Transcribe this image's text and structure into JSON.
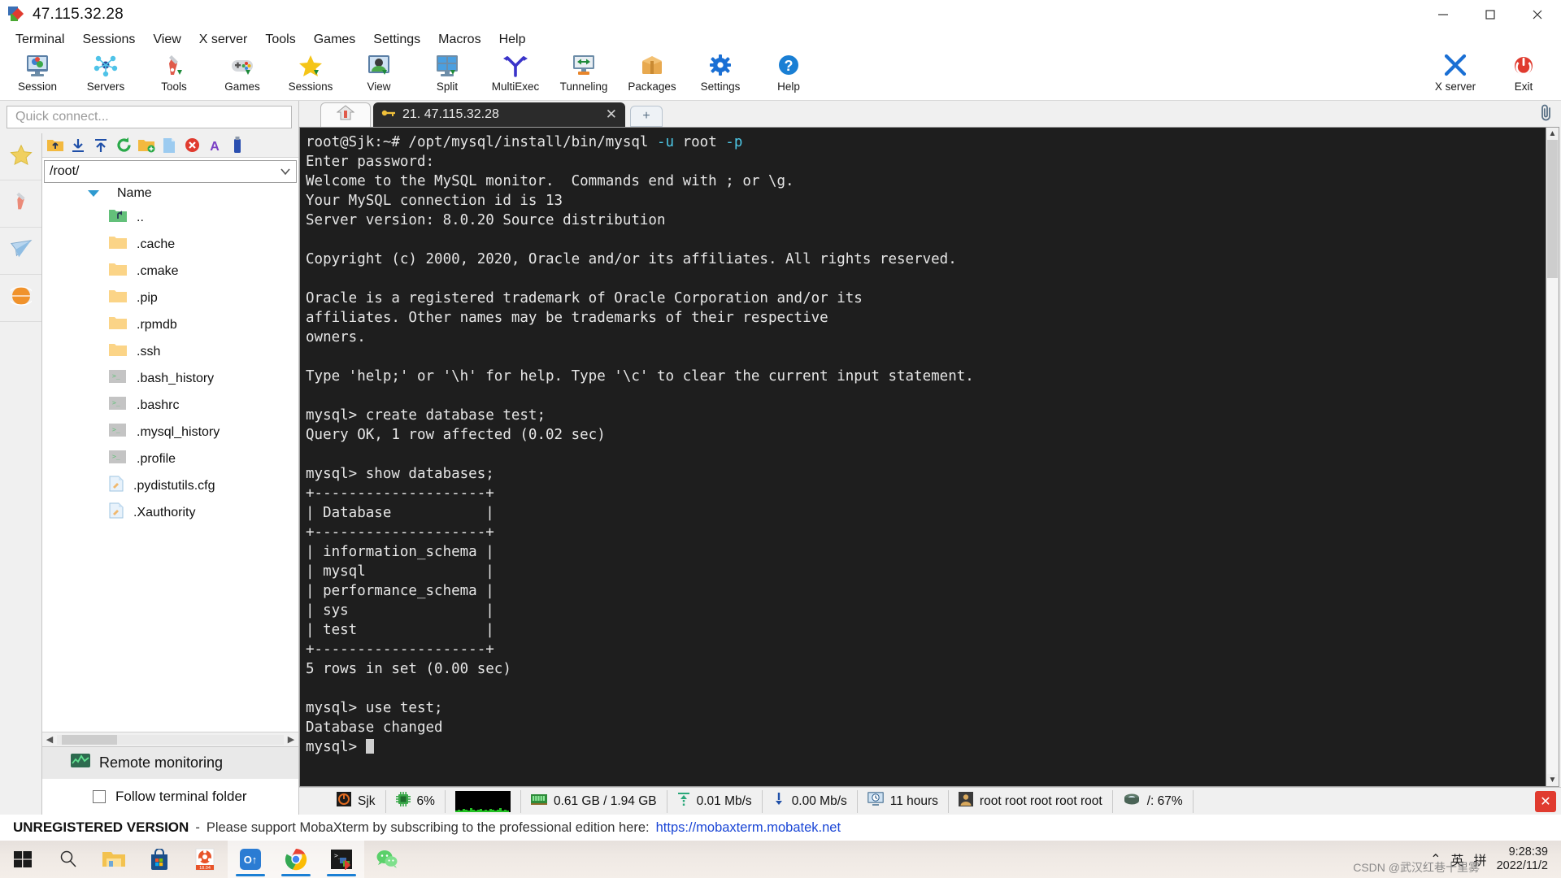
{
  "window": {
    "title": "47.115.32.28",
    "icon": "mobaxterm-logo-icon",
    "minimize": "−",
    "maximize": "▢",
    "close": "✕"
  },
  "menubar": {
    "items": [
      {
        "label": "Terminal"
      },
      {
        "label": "Sessions"
      },
      {
        "label": "View"
      },
      {
        "label": "X server"
      },
      {
        "label": "Tools"
      },
      {
        "label": "Games"
      },
      {
        "label": "Settings"
      },
      {
        "label": "Macros"
      },
      {
        "label": "Help"
      }
    ]
  },
  "ribbon": {
    "buttons": [
      {
        "label": "Session",
        "icon": "session-monitor-icon"
      },
      {
        "label": "Servers",
        "icon": "servers-network-icon"
      },
      {
        "label": "Tools",
        "icon": "swiss-knife-icon"
      },
      {
        "label": "Games",
        "icon": "gamepad-icon"
      },
      {
        "label": "Sessions",
        "icon": "star-icon"
      },
      {
        "label": "View",
        "icon": "view-person-icon"
      },
      {
        "label": "Split",
        "icon": "split-grid-icon"
      },
      {
        "label": "MultiExec",
        "icon": "multiexec-fork-icon"
      },
      {
        "label": "Tunneling",
        "icon": "tunneling-arrows-icon"
      },
      {
        "label": "Packages",
        "icon": "packages-box-icon"
      },
      {
        "label": "Settings",
        "icon": "settings-gear-icon"
      },
      {
        "label": "Help",
        "icon": "help-question-icon"
      }
    ],
    "right_buttons": [
      {
        "label": "X server",
        "icon": "x-server-icon"
      },
      {
        "label": "Exit",
        "icon": "power-exit-icon"
      }
    ]
  },
  "sidebar": {
    "quick_connect_placeholder": "Quick connect...",
    "vertical_tabs": [
      {
        "name": "sessions-star-tab",
        "icon": "star-icon"
      },
      {
        "name": "tools-tab",
        "icon": "swiss-knife-icon"
      },
      {
        "name": "sftp-tab",
        "icon": "paper-plane-icon"
      },
      {
        "name": "macros-tab",
        "icon": "globe-icon"
      }
    ],
    "file_toolbar": [
      {
        "name": "parent-folder-button",
        "icon": "folder-up-icon"
      },
      {
        "name": "download-button",
        "icon": "download-arrow-icon"
      },
      {
        "name": "upload-button",
        "icon": "upload-arrow-icon"
      },
      {
        "name": "refresh-button",
        "icon": "refresh-circle-icon"
      },
      {
        "name": "new-folder-button",
        "icon": "new-folder-icon"
      },
      {
        "name": "new-file-button",
        "icon": "new-file-icon"
      },
      {
        "name": "delete-button",
        "icon": "delete-red-x-icon"
      },
      {
        "name": "text-mode-button",
        "icon": "text-A-icon"
      },
      {
        "name": "binary-mode-button",
        "icon": "usb-stick-icon"
      }
    ],
    "path": "/root/",
    "column_header": "Name",
    "files": [
      {
        "name": "..",
        "type": "parent"
      },
      {
        "name": ".cache",
        "type": "folder"
      },
      {
        "name": ".cmake",
        "type": "folder"
      },
      {
        "name": ".pip",
        "type": "folder"
      },
      {
        "name": ".rpmdb",
        "type": "folder"
      },
      {
        "name": ".ssh",
        "type": "folder"
      },
      {
        "name": ".bash_history",
        "type": "script"
      },
      {
        "name": ".bashrc",
        "type": "script"
      },
      {
        "name": ".mysql_history",
        "type": "script"
      },
      {
        "name": ".profile",
        "type": "script"
      },
      {
        "name": ".pydistutils.cfg",
        "type": "file"
      },
      {
        "name": ".Xauthority",
        "type": "file"
      }
    ],
    "remote_monitoring": "Remote monitoring",
    "follow_terminal_folder": "Follow terminal folder"
  },
  "tabs": {
    "home_icon": "home-icon",
    "session": {
      "label": "21. 47.115.32.28",
      "icon": "ssh-key-icon",
      "close": "✕"
    },
    "new_tab": "+",
    "clip_icon": "paperclip-icon"
  },
  "terminal": {
    "lines": [
      {
        "segments": [
          {
            "t": "root@Sjk:~# /opt/mysql/install/bin/mysql ",
            "c": "w"
          },
          {
            "t": "-u",
            "c": "cy"
          },
          {
            "t": " root ",
            "c": "w"
          },
          {
            "t": "-p",
            "c": "cy"
          }
        ]
      },
      {
        "segments": [
          {
            "t": "Enter password:",
            "c": "w"
          }
        ]
      },
      {
        "segments": [
          {
            "t": "Welcome to the MySQL monitor.  Commands end with ; or \\g.",
            "c": "w"
          }
        ]
      },
      {
        "segments": [
          {
            "t": "Your MySQL connection id is 13",
            "c": "w"
          }
        ]
      },
      {
        "segments": [
          {
            "t": "Server version: 8.0.20 Source distribution",
            "c": "w"
          }
        ]
      },
      {
        "segments": [
          {
            "t": "",
            "c": "w"
          }
        ]
      },
      {
        "segments": [
          {
            "t": "Copyright (c) 2000, 2020, Oracle and/or its affiliates. All rights reserved.",
            "c": "w"
          }
        ]
      },
      {
        "segments": [
          {
            "t": "",
            "c": "w"
          }
        ]
      },
      {
        "segments": [
          {
            "t": "Oracle is a registered trademark of Oracle Corporation and/or its",
            "c": "w"
          }
        ]
      },
      {
        "segments": [
          {
            "t": "affiliates. Other names may be trademarks of their respective",
            "c": "w"
          }
        ]
      },
      {
        "segments": [
          {
            "t": "owners.",
            "c": "w"
          }
        ]
      },
      {
        "segments": [
          {
            "t": "",
            "c": "w"
          }
        ]
      },
      {
        "segments": [
          {
            "t": "Type 'help;' or '\\h' for help. Type '\\c' to clear the current input statement.",
            "c": "w"
          }
        ]
      },
      {
        "segments": [
          {
            "t": "",
            "c": "w"
          }
        ]
      },
      {
        "segments": [
          {
            "t": "mysql> create database test;",
            "c": "w"
          }
        ]
      },
      {
        "segments": [
          {
            "t": "Query OK, 1 row affected (0.02 sec)",
            "c": "w"
          }
        ]
      },
      {
        "segments": [
          {
            "t": "",
            "c": "w"
          }
        ]
      },
      {
        "segments": [
          {
            "t": "mysql> show databases;",
            "c": "w"
          }
        ]
      },
      {
        "segments": [
          {
            "t": "+--------------------+",
            "c": "w"
          }
        ]
      },
      {
        "segments": [
          {
            "t": "| Database           |",
            "c": "w"
          }
        ]
      },
      {
        "segments": [
          {
            "t": "+--------------------+",
            "c": "w"
          }
        ]
      },
      {
        "segments": [
          {
            "t": "| information_schema |",
            "c": "w"
          }
        ]
      },
      {
        "segments": [
          {
            "t": "| mysql              |",
            "c": "w"
          }
        ]
      },
      {
        "segments": [
          {
            "t": "| performance_schema |",
            "c": "w"
          }
        ]
      },
      {
        "segments": [
          {
            "t": "| sys                |",
            "c": "w"
          }
        ]
      },
      {
        "segments": [
          {
            "t": "| test               |",
            "c": "w"
          }
        ]
      },
      {
        "segments": [
          {
            "t": "+--------------------+",
            "c": "w"
          }
        ]
      },
      {
        "segments": [
          {
            "t": "5 rows in set (0.00 sec)",
            "c": "w"
          }
        ]
      },
      {
        "segments": [
          {
            "t": "",
            "c": "w"
          }
        ]
      },
      {
        "segments": [
          {
            "t": "mysql> use test;",
            "c": "w"
          }
        ]
      },
      {
        "segments": [
          {
            "t": "Database changed",
            "c": "w"
          }
        ]
      },
      {
        "segments": [
          {
            "t": "mysql> ",
            "c": "w"
          },
          {
            "t": "",
            "c": "cursor"
          }
        ]
      }
    ]
  },
  "statusbar": {
    "cells": [
      {
        "name": "host-name",
        "icon": "server-icon",
        "value": "Sjk"
      },
      {
        "name": "cpu-usage",
        "icon": "cpu-chip-icon",
        "value": "6%"
      },
      {
        "name": "cpu-graph",
        "icon": "graph-icon",
        "value": ""
      },
      {
        "name": "memory-usage",
        "icon": "memory-ram-icon",
        "value": "0.61 GB / 1.94 GB"
      },
      {
        "name": "upload-speed",
        "icon": "upload-arrow-icon",
        "value": "0.01 Mb/s"
      },
      {
        "name": "download-speed",
        "icon": "download-arrow-icon",
        "value": "0.00 Mb/s"
      },
      {
        "name": "uptime",
        "icon": "clock-monitor-icon",
        "value": "11 hours"
      },
      {
        "name": "logged-users",
        "icon": "user-icon",
        "value": "root  root  root  root  root"
      },
      {
        "name": "disk-usage",
        "icon": "hard-disk-icon",
        "value": "/: 67%"
      }
    ],
    "close_label": "✕"
  },
  "banner": {
    "title": "UNREGISTERED VERSION",
    "dash": "-",
    "message": "Please support MobaXterm by subscribing to the professional edition here:",
    "link": "https://mobaxterm.mobatek.net",
    "link_color": "#1a46d6"
  },
  "taskbar": {
    "items": [
      {
        "name": "start-button",
        "icon": "windows-logo-icon",
        "active": false
      },
      {
        "name": "search-button",
        "icon": "search-magnifier-icon",
        "active": false
      },
      {
        "name": "file-explorer-button",
        "icon": "folder-icon",
        "active": false
      },
      {
        "name": "microsoft-store-button",
        "icon": "store-bag-icon",
        "active": false
      },
      {
        "name": "ubuntu-wsl-button",
        "icon": "ubuntu-1804-icon",
        "active": false,
        "badge": "18.04"
      },
      {
        "name": "outlook-button",
        "icon": "outlook-icon",
        "active": true
      },
      {
        "name": "chrome-button",
        "icon": "chrome-icon",
        "active": true
      },
      {
        "name": "mobaxterm-button",
        "icon": "mobaxterm-logo-icon",
        "active": true
      },
      {
        "name": "wechat-button",
        "icon": "wechat-icon",
        "active": false
      }
    ],
    "tray": {
      "expand": "⌃",
      "ime_lang": "英",
      "ime_mode": "拼"
    },
    "clock": {
      "time": "9:28:39",
      "date": "2022/11/2"
    },
    "watermark": "CSDN @武汉红巷十里雾"
  }
}
